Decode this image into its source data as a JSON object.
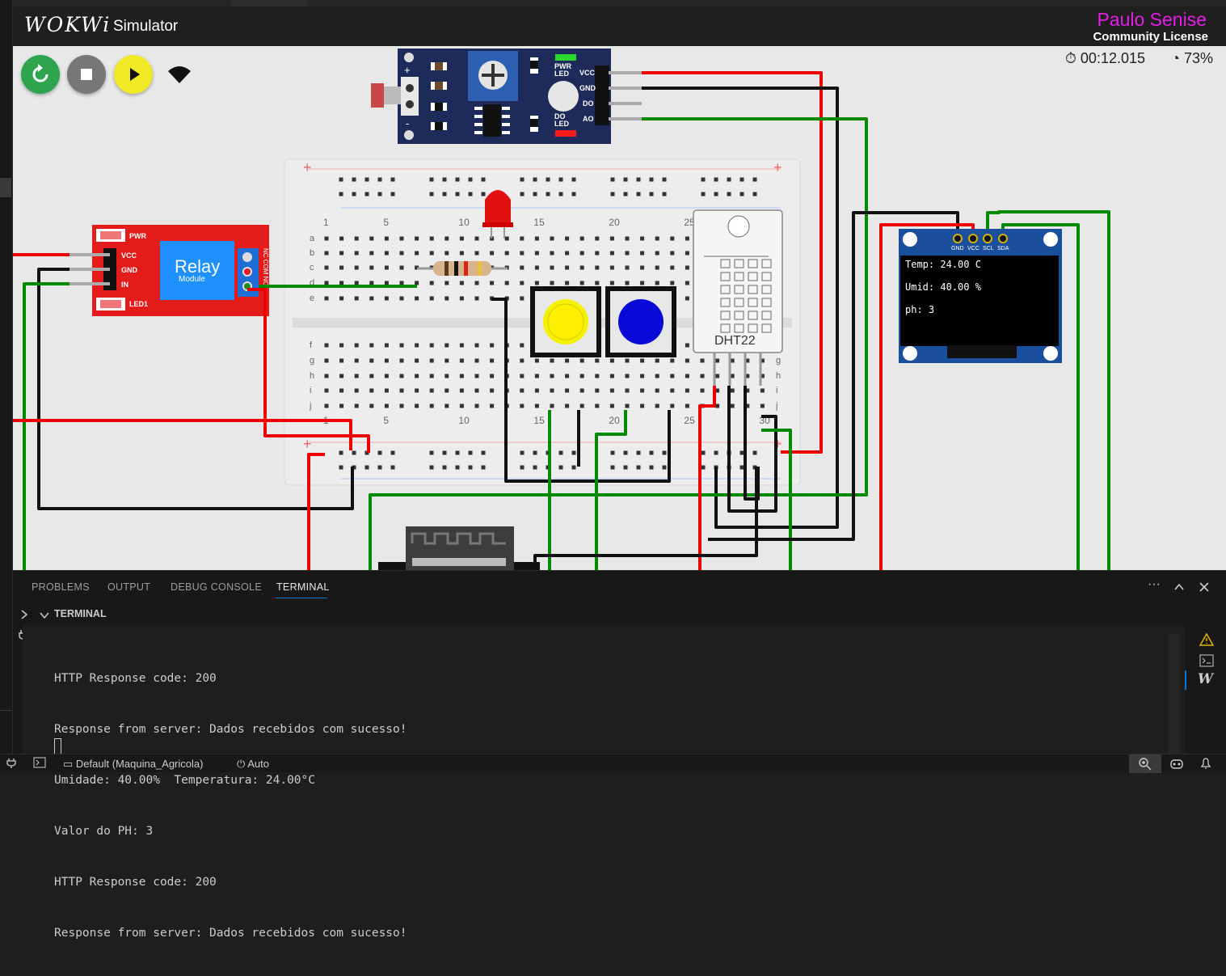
{
  "app": {
    "logo": "WOKWi",
    "title": "Simulator",
    "license_name": "Paulo Senise",
    "license_type": "Community License"
  },
  "sim": {
    "timer": "00:12.015",
    "speed": "73%",
    "controls": [
      "restart-icon",
      "stop-icon",
      "play-icon",
      "wifi-icon"
    ]
  },
  "components": {
    "sensor_pins": [
      "VCC",
      "GND",
      "DO",
      "AO"
    ],
    "sensor_labels": [
      "PWR LED",
      "DO LED"
    ],
    "relay_label": "Relay",
    "relay_sub": "Module",
    "relay_pins": [
      "PWR",
      "VCC",
      "GND",
      "IN",
      "LED1"
    ],
    "relay_terminals": "NC COM NO",
    "dht_label": "DHT22",
    "breadboard_cols": [
      "1",
      "5",
      "10",
      "15",
      "20",
      "25",
      "30"
    ],
    "breadboard_rows_top": [
      "a",
      "b",
      "c",
      "d",
      "e"
    ],
    "breadboard_rows_bottom": [
      "f",
      "g",
      "h",
      "i",
      "j"
    ],
    "oled_pins": [
      "GND",
      "VCC",
      "SCL",
      "SDA"
    ],
    "oled_lines": [
      "Temp: 24.00 C",
      "Umid: 40.00 %",
      "ph: 3"
    ]
  },
  "panel": {
    "tabs": [
      "PROBLEMS",
      "OUTPUT",
      "DEBUG CONSOLE",
      "TERMINAL"
    ],
    "active_tab": "TERMINAL",
    "terminal_title": "TERMINAL",
    "terminal_lines": [
      "HTTP Response code: 200",
      "Response from server: Dados recebidos com sucesso!",
      "Umidade: 40.00%  Temperatura: 24.00°C",
      "Valor do PH: 3",
      "HTTP Response code: 200",
      "Response from server: Dados recebidos com sucesso!"
    ]
  },
  "statusbar": {
    "profile": "Default (Maquina_Agricola)",
    "mode": "Auto"
  },
  "colors": {
    "wire_red": "#ee0000",
    "wire_black": "#111111",
    "wire_green": "#008a00",
    "relay_red": "#e41b1b",
    "sensor_blue": "#1d2a5a",
    "license_magenta": "#e51de8"
  }
}
